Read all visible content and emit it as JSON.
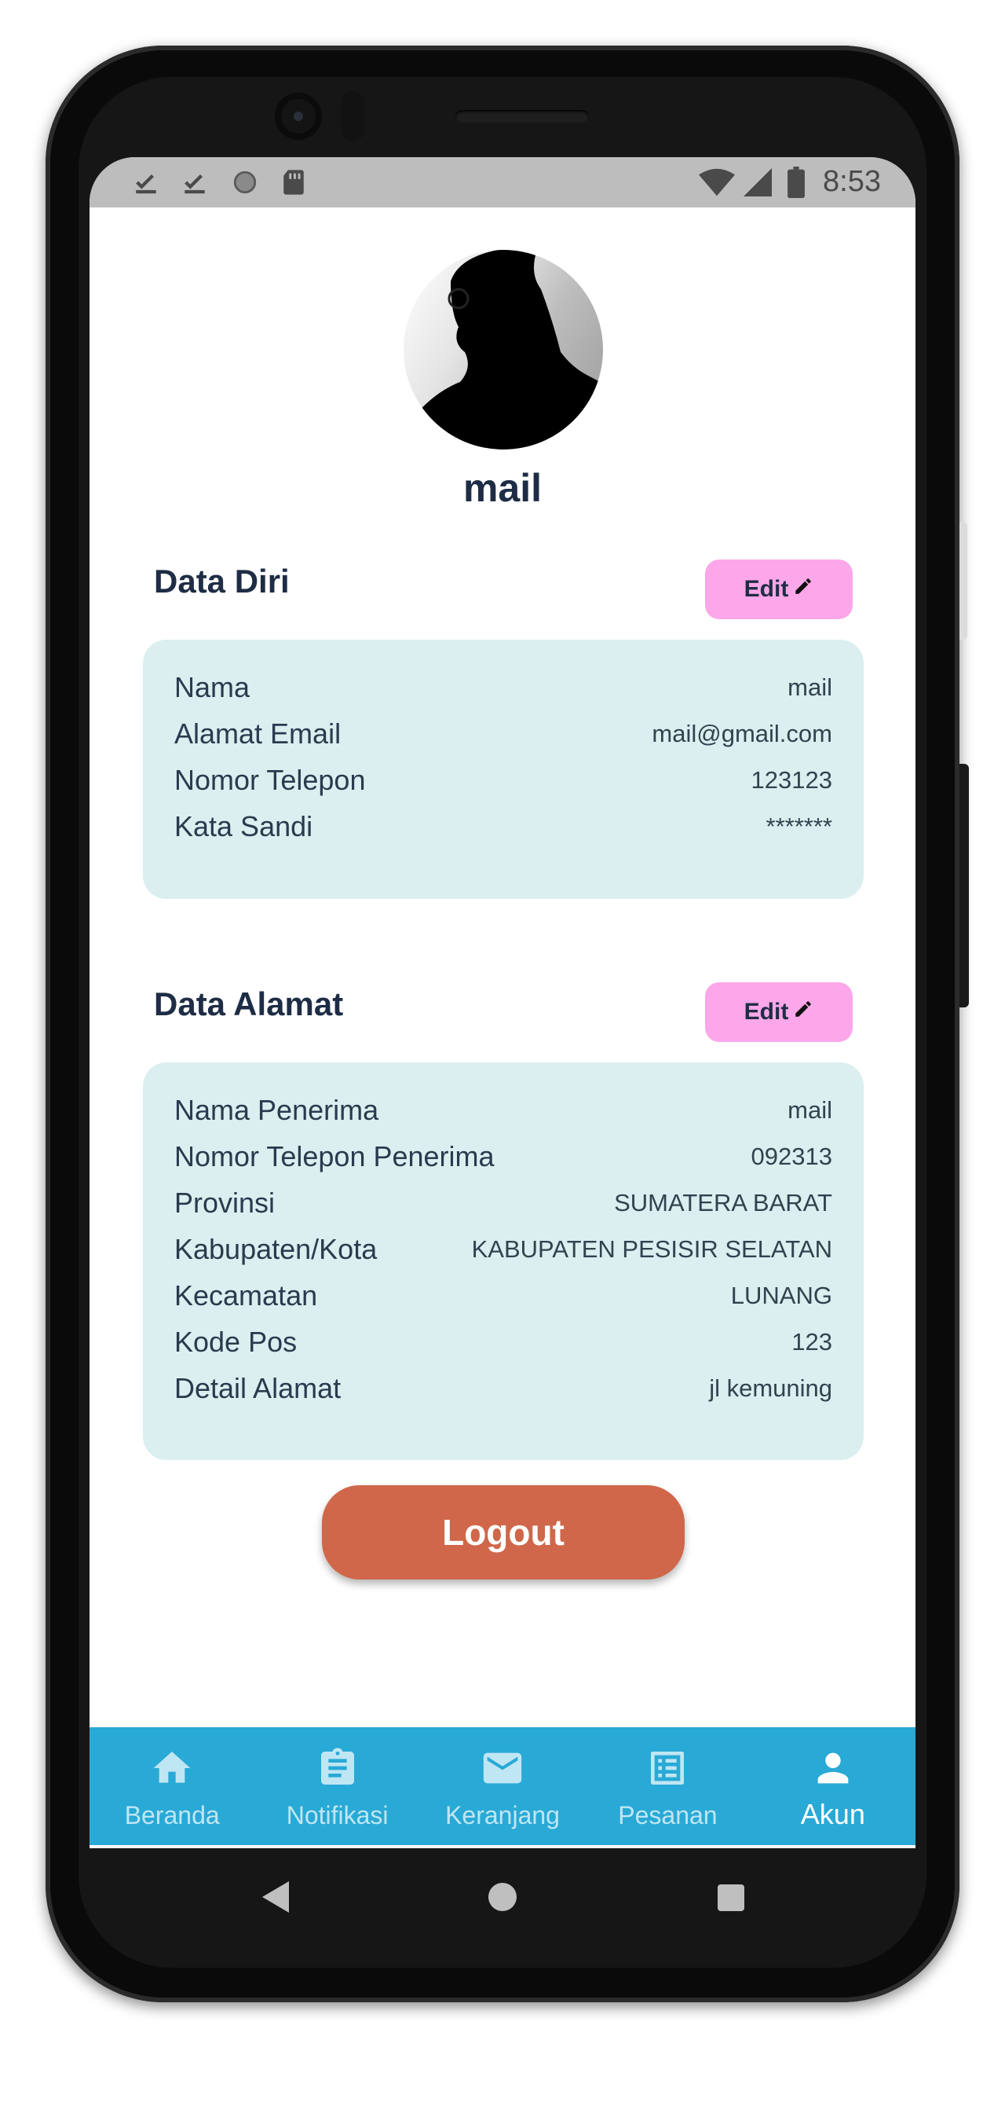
{
  "status_bar": {
    "time": "8:53",
    "left_icons": [
      "check-download-icon",
      "check-download-icon",
      "circle-icon",
      "sd-card-icon"
    ],
    "right_icons": [
      "wifi-icon",
      "signal-icon",
      "battery-icon"
    ]
  },
  "profile": {
    "username": "mail"
  },
  "data_diri": {
    "title": "Data Diri",
    "edit_label": "Edit",
    "rows": [
      {
        "label": "Nama",
        "value": "mail"
      },
      {
        "label": "Alamat Email",
        "value": "mail@gmail.com"
      },
      {
        "label": "Nomor Telepon",
        "value": "123123"
      },
      {
        "label": "Kata Sandi",
        "value": "*******"
      }
    ]
  },
  "data_alamat": {
    "title": "Data Alamat",
    "edit_label": "Edit",
    "rows": [
      {
        "label": "Nama Penerima",
        "value": "mail"
      },
      {
        "label": "Nomor Telepon Penerima",
        "value": "092313"
      },
      {
        "label": "Provinsi",
        "value": "SUMATERA BARAT"
      },
      {
        "label": "Kabupaten/Kota",
        "value": "KABUPATEN PESISIR SELATAN"
      },
      {
        "label": "Kecamatan",
        "value": "LUNANG"
      },
      {
        "label": "Kode Pos",
        "value": "123"
      },
      {
        "label": "Detail Alamat",
        "value": "jl kemuning"
      }
    ]
  },
  "logout_label": "Logout",
  "bottom_nav": {
    "items": [
      {
        "label": "Beranda",
        "icon": "home-icon"
      },
      {
        "label": "Notifikasi",
        "icon": "clipboard-icon"
      },
      {
        "label": "Keranjang",
        "icon": "mail-icon"
      },
      {
        "label": "Pesanan",
        "icon": "list-icon"
      },
      {
        "label": "Akun",
        "icon": "person-icon",
        "active": true
      }
    ]
  },
  "colors": {
    "brand_nav": "#29a9d6",
    "edit_button": "#fca7e9",
    "logout_button": "#d0674a",
    "card_background": "#dbeff0",
    "heading_text": "#1e2d45"
  }
}
